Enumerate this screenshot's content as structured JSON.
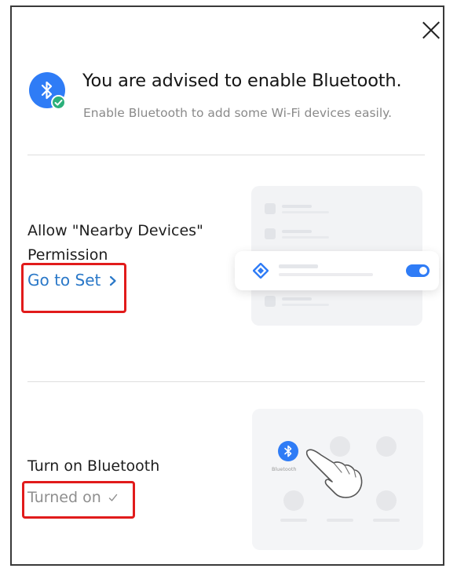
{
  "dialog": {
    "title": "You are advised to enable Bluetooth.",
    "subtitle": "Enable Bluetooth to add some Wi-Fi devices easily.",
    "header_icon": "bluetooth-icon",
    "close_icon": "close-icon"
  },
  "permission_step": {
    "label": "Allow \"Nearby Devices\" Permission",
    "link_label": "Go to Set",
    "link_icon": "chevron-right-icon"
  },
  "bluetooth_step": {
    "label": "Turn on Bluetooth",
    "status_label": "Turned on",
    "status_icon": "checkmark-icon",
    "illustration_caption": "Bluetooth"
  },
  "colors": {
    "accent_blue": "#2f7cf6",
    "link_blue": "#2a78c8",
    "highlight_red": "#e11b1b",
    "success_green": "#2bb07a"
  }
}
